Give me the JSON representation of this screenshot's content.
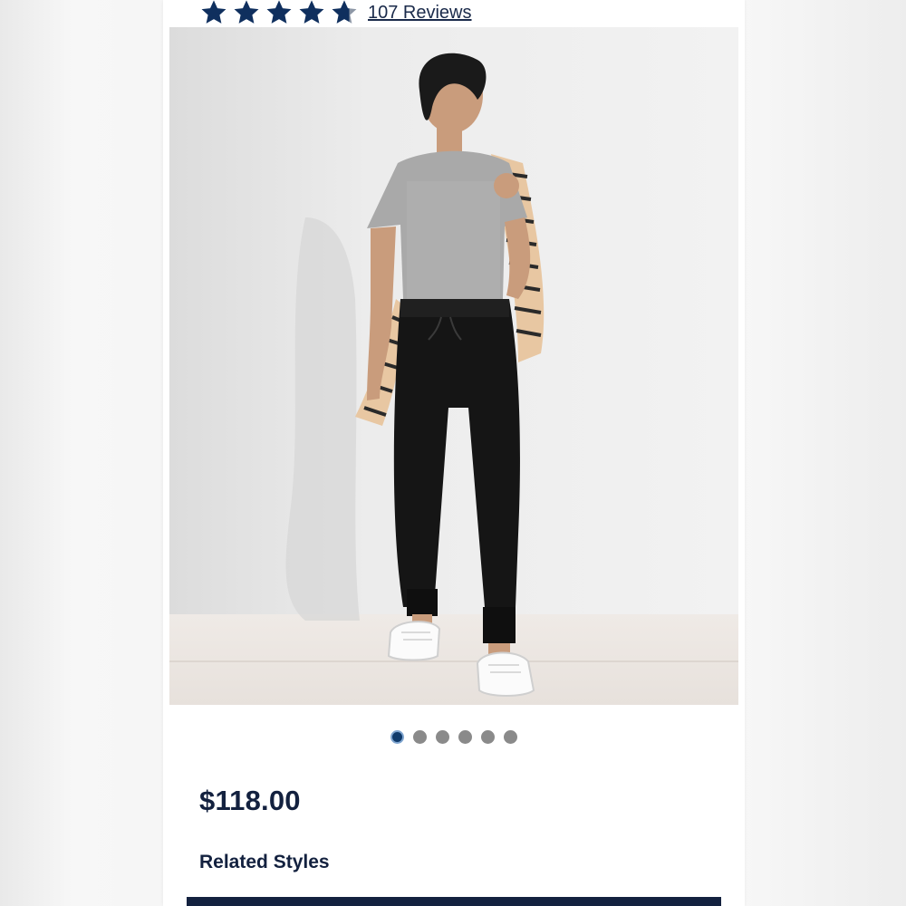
{
  "rating": {
    "stars_filled": 4.7,
    "stars_total": 5,
    "reviews_label": "107 Reviews"
  },
  "product": {
    "price": "$118.00",
    "image_icon": "product-photo"
  },
  "carousel": {
    "dot_count": 6,
    "active_index": 0
  },
  "sections": {
    "related_styles": "Related Styles"
  },
  "colors": {
    "brand_navy": "#13213f",
    "star_navy": "#0f2f5e",
    "dot_inactive": "#8a8a8a",
    "dot_active": "#0f3a6b"
  }
}
